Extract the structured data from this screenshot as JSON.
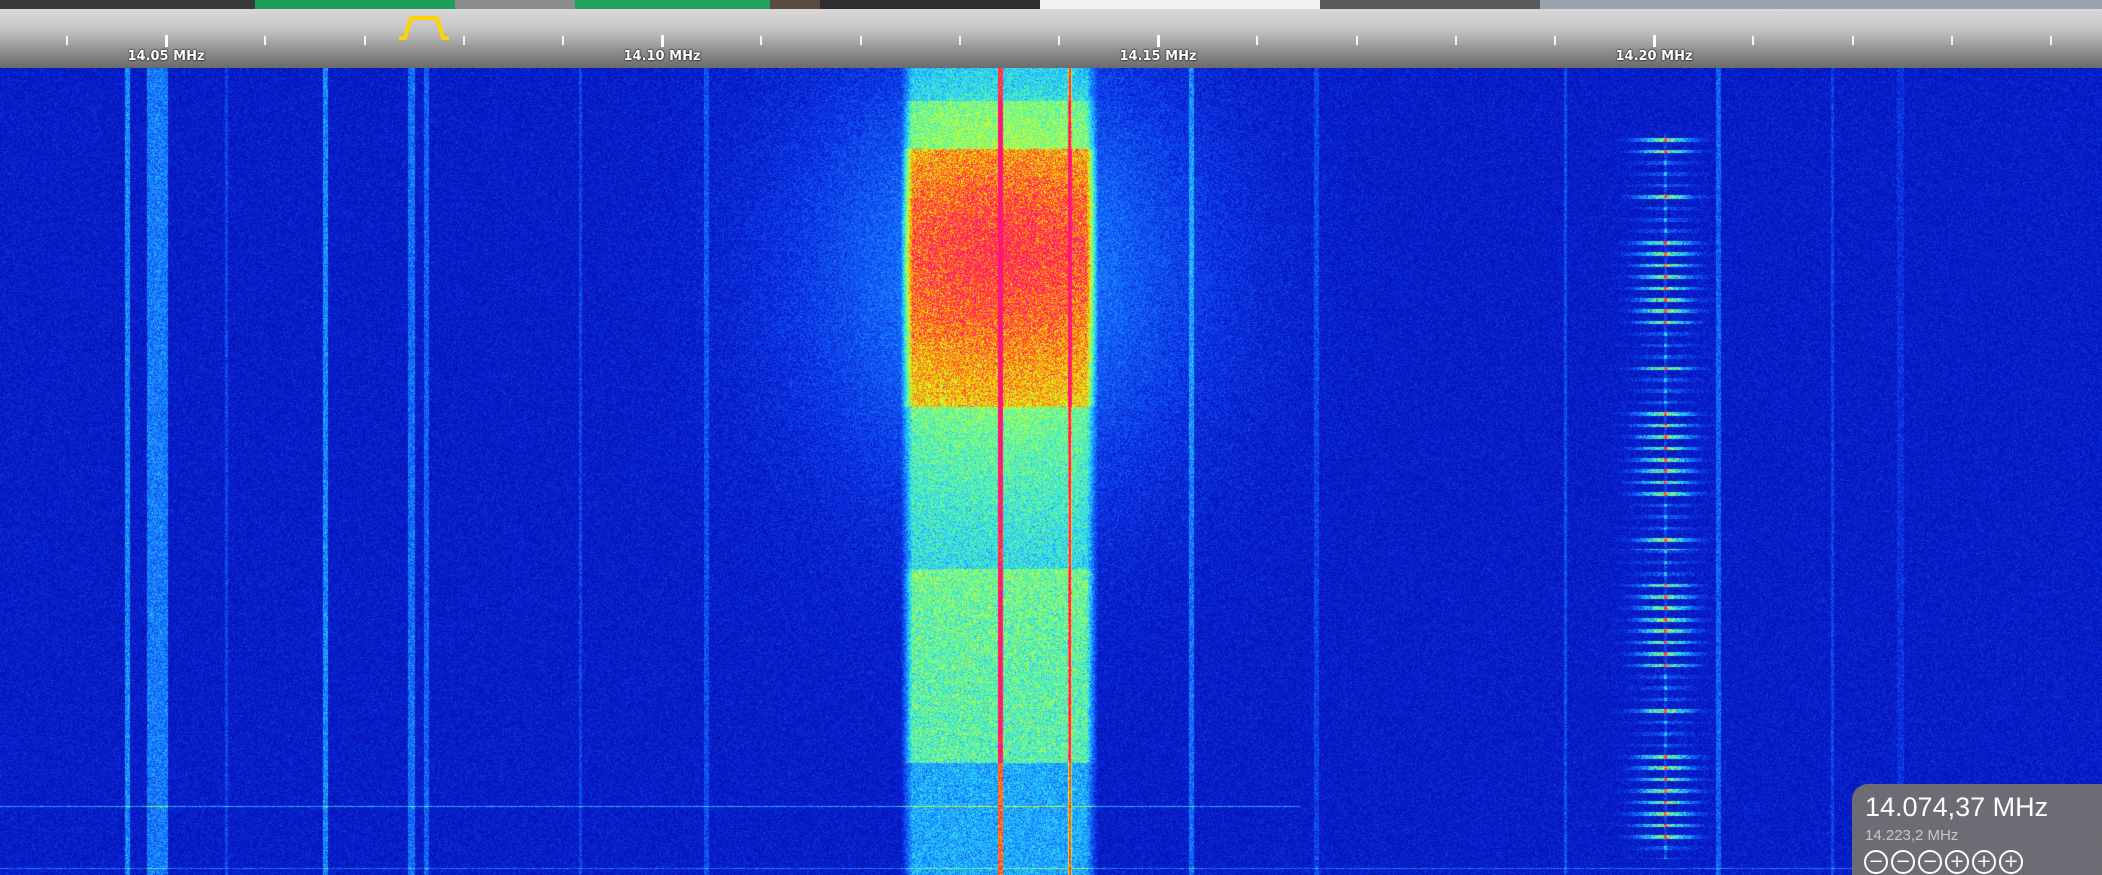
{
  "frequency_scale": {
    "labels": [
      "14.05 MHz",
      "14.10 MHz",
      "14.15 MHz",
      "14.20 MHz"
    ],
    "unit": "MHz"
  },
  "colors": {
    "scale_bg": "#bfbfbf",
    "tick": "#ffffff",
    "passband": "#ffd400",
    "waterfall_bg": "#0616c2",
    "panel_bg": "#707070"
  },
  "frequency_display": {
    "main": "14.074,37 MHz",
    "secondary": "14.223,2 MHz"
  },
  "zoom_controls": [
    {
      "icon": "zoom-out-max-icon",
      "glyph": "⊖"
    },
    {
      "icon": "zoom-out-icon",
      "glyph": "⊖"
    },
    {
      "icon": "zoom-out-small-icon",
      "glyph": "⊖"
    },
    {
      "icon": "zoom-in-small-icon",
      "glyph": "⊕"
    },
    {
      "icon": "zoom-in-icon",
      "glyph": "⊕"
    },
    {
      "icon": "zoom-in-max-icon",
      "glyph": "⊕"
    }
  ]
}
